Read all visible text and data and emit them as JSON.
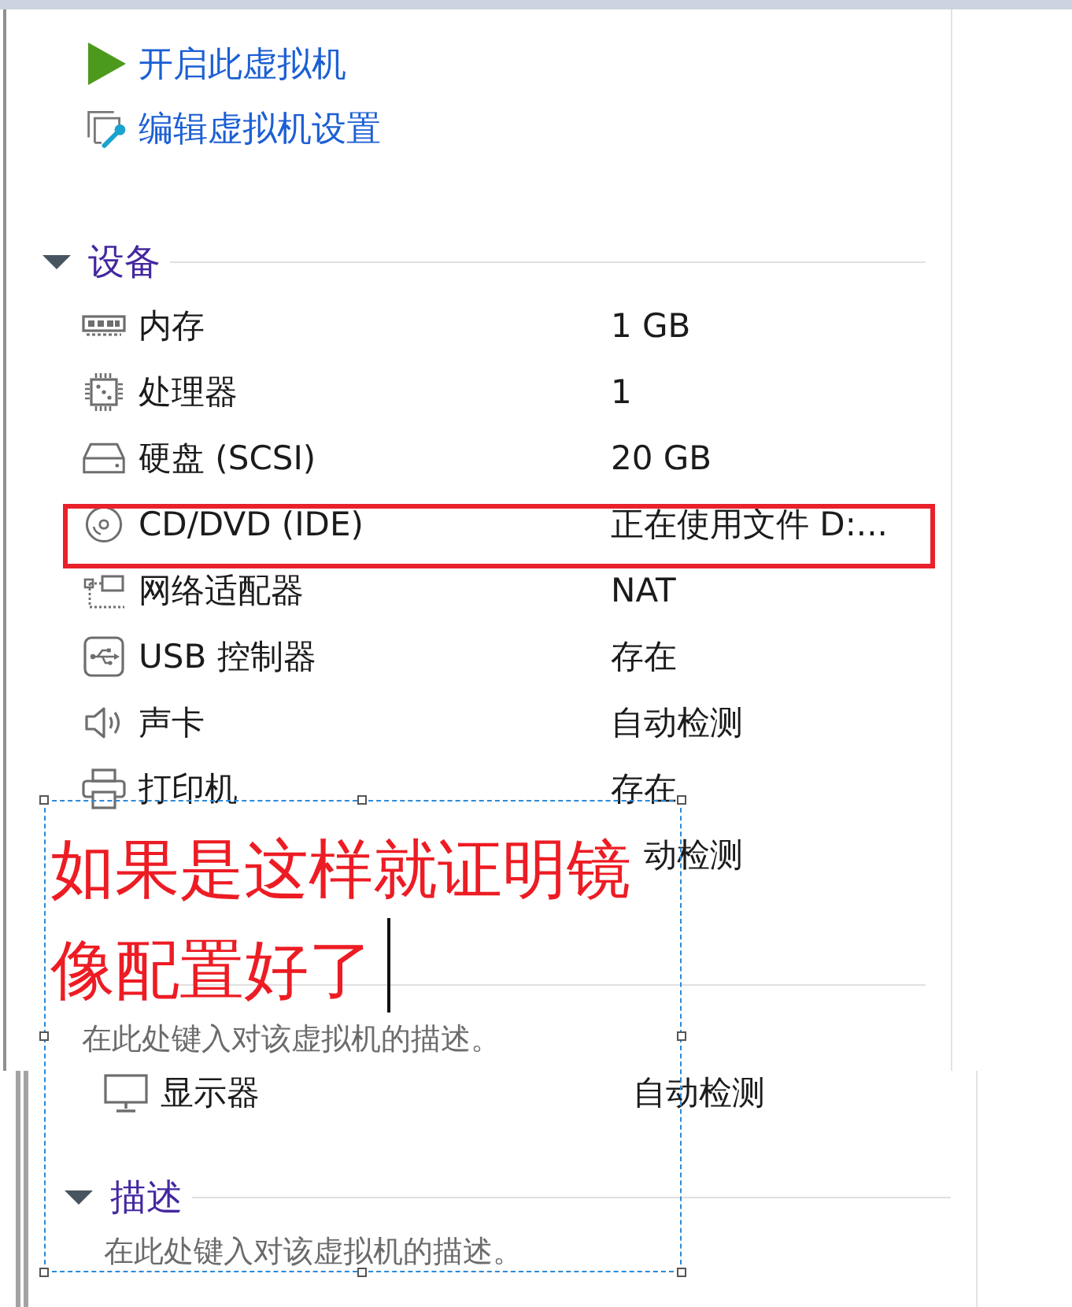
{
  "vm_panel": {
    "actions": [
      {
        "kind": "power_on",
        "label": "开启此虚拟机"
      },
      {
        "kind": "edit_settings",
        "label": "编辑虚拟机设置"
      }
    ],
    "devices": {
      "title": "设备",
      "expanded": true,
      "items": [
        {
          "kind": "memory",
          "name": "内存",
          "value": "1 GB",
          "highlighted": false
        },
        {
          "kind": "processor",
          "name": "处理器",
          "value": "1",
          "highlighted": false
        },
        {
          "kind": "disk",
          "name": "硬盘 (SCSI)",
          "value": "20 GB",
          "highlighted": false
        },
        {
          "kind": "cdrom",
          "name": "CD/DVD (IDE)",
          "value": "正在使用文件 D:...",
          "highlighted": true
        },
        {
          "kind": "network",
          "name": "网络适配器",
          "value": "NAT",
          "highlighted": false
        },
        {
          "kind": "usb",
          "name": "USB 控制器",
          "value": "存在",
          "highlighted": false
        },
        {
          "kind": "sound",
          "name": "声卡",
          "value": "自动检测",
          "highlighted": false
        },
        {
          "kind": "printer",
          "name": "打印机",
          "value": "存在",
          "highlighted": false
        },
        {
          "value": "动检测",
          "highlighted": false,
          "covered": true
        }
      ]
    },
    "description": {
      "placeholder": "在此处键入对该虚拟机的描述。"
    }
  },
  "second_capture": {
    "devices": {
      "items": [
        {
          "kind": "display",
          "name": "显示器",
          "value": "自动检测",
          "highlighted": false
        }
      ]
    },
    "description": {
      "title": "描述",
      "expanded": true,
      "placeholder": "在此处键入对该虚拟机的描述。"
    }
  },
  "annotation": {
    "text": "如果是这样就证明镜像配置好了",
    "editing": true
  }
}
